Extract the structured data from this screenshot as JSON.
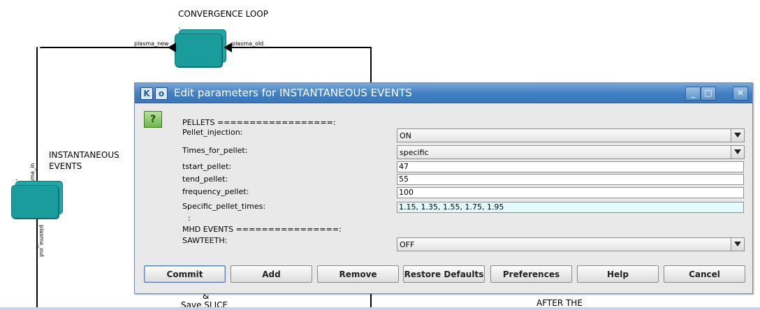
{
  "canvas": {
    "convergence_title": "CONVERGENCE    LOOP",
    "instantaneous_title_line1": "INSTANTANEOUS",
    "instantaneous_title_line2": "EVENTS",
    "port_plasma_new": "plasma_new",
    "port_plasma_old": "plasma_old",
    "port_plasma_in": "plasma_in",
    "port_plasma_out": "plasma_out",
    "dot_mark": ".",
    "bottom_label_amp": "&",
    "bottom_label_save": "Save SLICE",
    "bottom_label_after": "AFTER THE",
    "actor_color": "#1a9c9c"
  },
  "dialog": {
    "title": "Edit parameters for INSTANTANEOUS EVENTS",
    "icon_k": "K",
    "icon_o": "o",
    "minimize_glyph": "_",
    "maximize_glyph": "□",
    "close_glyph": "✕",
    "help_glyph": "?",
    "title_bar_color": "#3f7fc2",
    "section_pellets": "PELLETS ==================:",
    "params": {
      "pellet_injection": {
        "label": "Pellet_injection:",
        "value": "ON"
      },
      "times_for_pellet": {
        "label": "Times_for_pellet:",
        "value": "specific"
      },
      "tstart_pellet": {
        "label": "tstart_pellet:",
        "value": "47"
      },
      "tend_pellet": {
        "label": "tend_pellet:",
        "value": "55"
      },
      "frequency_pellet": {
        "label": "frequency_pellet:",
        "value": "100"
      },
      "specific_pellet_times": {
        "label": "Specific_pellet_times:",
        "value": "1.15, 1.35, 1.55, 1.75, 1.95"
      },
      "sawteeth": {
        "label": "SAWTEETH:",
        "value": "OFF"
      }
    },
    "ellipsis": ":",
    "section_mhd": "MHD EVENTS ================:",
    "buttons": {
      "commit": "Commit",
      "add": "Add",
      "remove": "Remove",
      "restore_defaults": "Restore Defaults",
      "preferences": "Preferences",
      "help": "Help",
      "cancel": "Cancel"
    }
  }
}
